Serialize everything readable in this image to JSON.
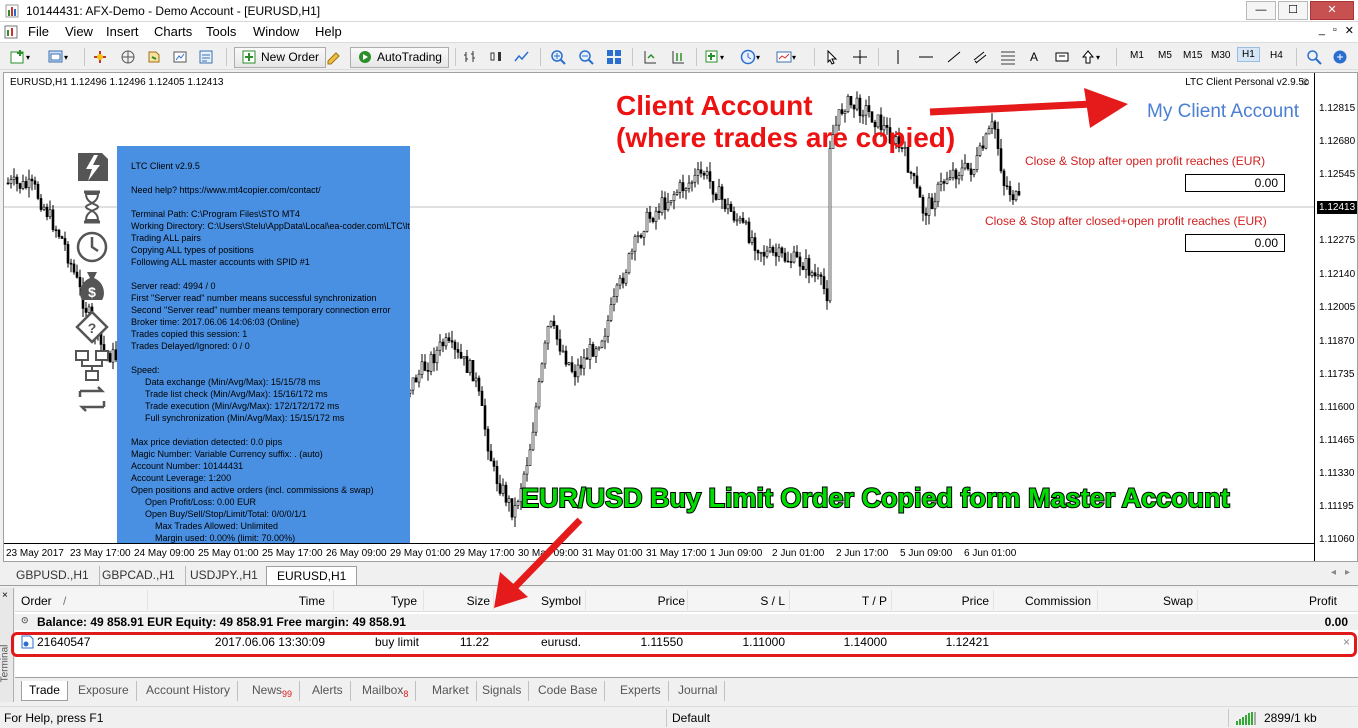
{
  "window": {
    "title": "10144431: AFX-Demo - Demo Account - [EURUSD,H1]",
    "minimize": "—",
    "maximize": "☐",
    "close": "✕"
  },
  "menu": [
    "File",
    "View",
    "Insert",
    "Charts",
    "Tools",
    "Window",
    "Help"
  ],
  "mdi_controls": [
    "_",
    "▫",
    "✕"
  ],
  "toolbar": {
    "new_order": "New Order",
    "autotrading": "AutoTrading",
    "timeframes": [
      "M1",
      "M5",
      "M15",
      "M30",
      "H1",
      "H4"
    ],
    "active_timeframe": "H1"
  },
  "chart": {
    "symbol_info": "EURUSD,H1  1.12496 1.12496 1.12405 1.12413",
    "ea_label": "LTC Client Personal v2.9.5c",
    "price_labels": [
      "1.12815",
      "1.12680",
      "1.12545",
      "1.12413",
      "1.12275",
      "1.12140",
      "1.12005",
      "1.11870",
      "1.11735",
      "1.11600",
      "1.11465",
      "1.11330",
      "1.11195",
      "1.11060"
    ],
    "current_price": "1.12413",
    "time_labels": [
      "23 May 2017",
      "23 May 17:00",
      "24 May 09:00",
      "25 May 01:00",
      "25 May 17:00",
      "26 May 09:00",
      "29 May 01:00",
      "29 May 17:00",
      "30 May 09:00",
      "31 May 01:00",
      "31 May 17:00",
      "1 Jun 09:00",
      "2 Jun 01:00",
      "2 Jun 17:00",
      "5 Jun 09:00",
      "6 Jun 01:00"
    ],
    "my_client_account": "My Client Account",
    "close_stop_open": "Close & Stop after open profit reaches (EUR)",
    "close_stop_open_value": "0.00",
    "close_stop_closed": "Close & Stop after closed+open profit reaches (EUR)",
    "close_stop_closed_value": "0.00"
  },
  "ltc_panel": {
    "lines": [
      {
        "t": "LTC Client v2.9.5",
        "c": ""
      },
      {
        "t": "",
        "c": "gap"
      },
      {
        "t": "Need help? https://www.mt4copier.com/contact/",
        "c": ""
      },
      {
        "t": "",
        "c": "gap"
      },
      {
        "t": "Terminal Path: C:\\Program Files\\STO MT4",
        "c": ""
      },
      {
        "t": "Working Directory: C:\\Users\\Stelu\\AppData\\Local\\ea-coder.com\\LTC\\ltctrades\\",
        "c": ""
      },
      {
        "t": "Trading ALL pairs",
        "c": ""
      },
      {
        "t": "Copying ALL types of positions",
        "c": ""
      },
      {
        "t": "Following ALL master accounts with SPID #1",
        "c": ""
      },
      {
        "t": "",
        "c": "gap"
      },
      {
        "t": "Server read: 4994 / 0",
        "c": ""
      },
      {
        "t": "First \"Server read\" number means successful synchronization",
        "c": ""
      },
      {
        "t": "Second \"Server read\" number means temporary connection error",
        "c": ""
      },
      {
        "t": "Broker time: 2017.06.06 14:06:03 (Online)",
        "c": ""
      },
      {
        "t": "Trades copied this session: 1",
        "c": ""
      },
      {
        "t": "Trades Delayed/Ignored: 0 / 0",
        "c": ""
      },
      {
        "t": "",
        "c": "gap"
      },
      {
        "t": "Speed:",
        "c": ""
      },
      {
        "t": "Data exchange (Min/Avg/Max): 15/15/78 ms",
        "c": "ind"
      },
      {
        "t": "Trade list check (Min/Avg/Max): 15/16/172 ms",
        "c": "ind"
      },
      {
        "t": "Trade execution (Min/Avg/Max): 172/172/172 ms",
        "c": "ind"
      },
      {
        "t": "Full synchronization (Min/Avg/Max): 15/15/172 ms",
        "c": "ind"
      },
      {
        "t": "",
        "c": "gap"
      },
      {
        "t": "Max price deviation detected: 0.0 pips",
        "c": ""
      },
      {
        "t": "Magic Number: Variable      Currency suffix: . (auto)",
        "c": ""
      },
      {
        "t": "Account Number: 10144431",
        "c": ""
      },
      {
        "t": "Account Leverage: 1:200",
        "c": ""
      },
      {
        "t": "Open positions and active orders (incl. commissions & swap)",
        "c": ""
      },
      {
        "t": "Open Profit/Loss: 0.00 EUR",
        "c": "ind"
      },
      {
        "t": "Open Buy/Sell/Stop/Limit/Total: 0/0/0/1/1",
        "c": "ind"
      },
      {
        "t": "Max Trades Allowed: Unlimited",
        "c": "ind2"
      },
      {
        "t": "Margin used: 0.00% (limit: 70.00%)",
        "c": "ind2"
      }
    ]
  },
  "annotations": {
    "client_line1": "Client Account",
    "client_line2": "(where trades are copied)",
    "eurusd": "EUR/USD Buy Limit Order Copied form Master Account"
  },
  "symbol_tabs": [
    "GBPUSD.,H1",
    "GBPCAD.,H1",
    "USDJPY.,H1",
    "EURUSD,H1"
  ],
  "active_symbol_tab": "EURUSD,H1",
  "terminal": {
    "side_label": "Terminal",
    "close": "×",
    "headers": {
      "order": "Order",
      "sort": "/",
      "time": "Time",
      "type": "Type",
      "size": "Size",
      "symbol": "Symbol",
      "price": "Price",
      "sl": "S / L",
      "tp": "T / P",
      "price2": "Price",
      "commission": "Commission",
      "swap": "Swap",
      "profit": "Profit"
    },
    "balance": "Balance: 49 858.91 EUR  Equity: 49 858.91  Free margin: 49 858.91",
    "balance_profit": "0.00",
    "order": {
      "id": "21640547",
      "time": "2017.06.06 13:30:09",
      "type": "buy limit",
      "size": "11.22",
      "symbol": "eurusd.",
      "price": "1.11550",
      "sl": "1.11000",
      "tp": "1.14000",
      "current_price": "1.12421",
      "close": "×"
    },
    "tabs": [
      {
        "label": "Trade",
        "badge": ""
      },
      {
        "label": "Exposure",
        "badge": ""
      },
      {
        "label": "Account History",
        "badge": ""
      },
      {
        "label": "News",
        "badge": "99"
      },
      {
        "label": "Alerts",
        "badge": ""
      },
      {
        "label": "Mailbox",
        "badge": "8"
      },
      {
        "label": "Market",
        "badge": ""
      },
      {
        "label": "Signals",
        "badge": ""
      },
      {
        "label": "Code Base",
        "badge": ""
      },
      {
        "label": "Experts",
        "badge": ""
      },
      {
        "label": "Journal",
        "badge": ""
      }
    ],
    "active_tab": "Trade"
  },
  "status": {
    "help": "For Help, press F1",
    "profile": "Default",
    "traffic": "2899/1 kb"
  },
  "colors": {
    "bull": "#000000",
    "bear": "#000000",
    "ltc_panel": "#4a90e2",
    "annotation_red": "#ee1111",
    "annotation_green": "#00dd00"
  }
}
